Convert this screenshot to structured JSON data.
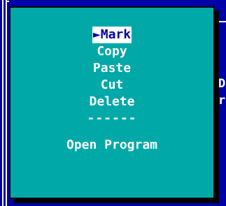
{
  "colors": {
    "screen_bg": "#0000a8",
    "menu_bg": "#00a8a8",
    "menu_text": "#ffffff",
    "selected_bg": "#ffffff",
    "selected_text": "#0000a8",
    "shadow": "#000000"
  },
  "background": {
    "right_text_line1": "D",
    "right_text_line2": "r"
  },
  "context_menu": {
    "items": [
      {
        "label": "Mark",
        "selected": true,
        "marker_icon": "triangle-right-icon"
      },
      {
        "label": "Copy",
        "selected": false
      },
      {
        "label": "Paste",
        "selected": false
      },
      {
        "label": "Cut",
        "selected": false
      },
      {
        "label": "Delete",
        "selected": false
      }
    ],
    "separator": "------",
    "open_program_label": "Open Program"
  }
}
